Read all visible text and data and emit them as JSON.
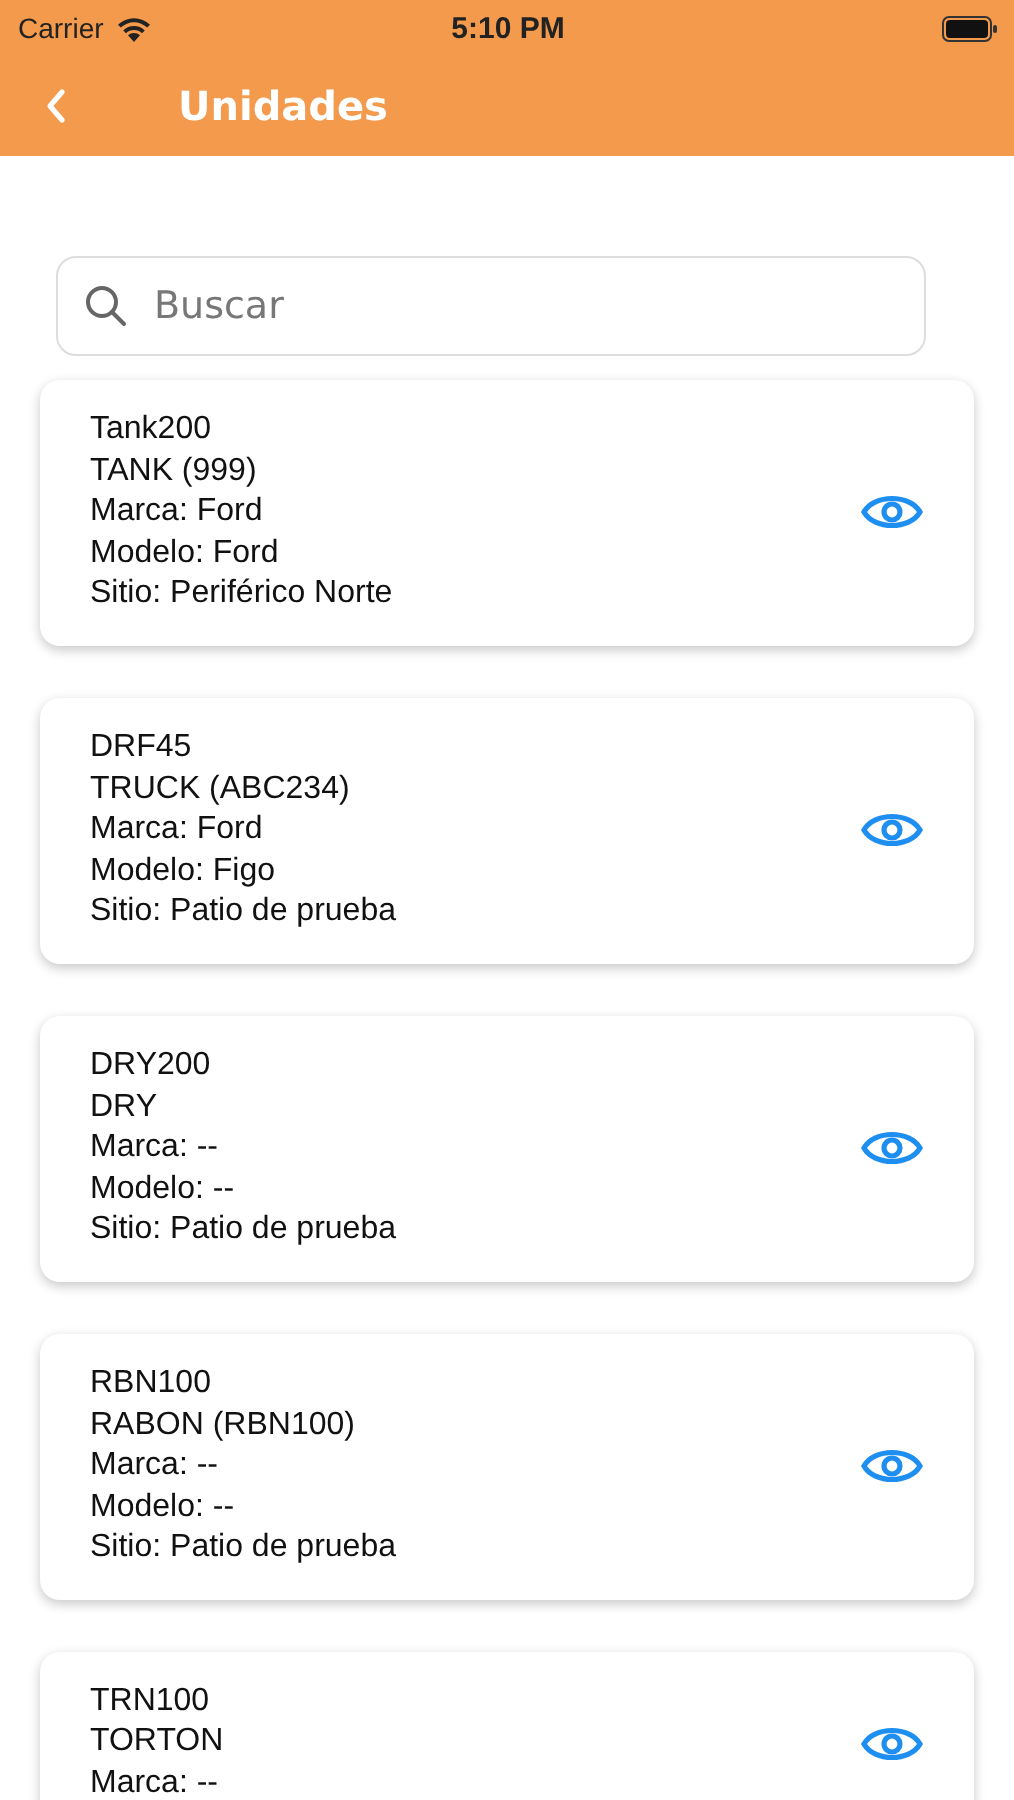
{
  "status_bar": {
    "carrier": "Carrier",
    "time": "5:10 PM"
  },
  "nav": {
    "title": "Unidades"
  },
  "search": {
    "placeholder": "Buscar"
  },
  "units": [
    {
      "lines": [
        "Tank200",
        "TANK (999)",
        "Marca: Ford",
        "Modelo: Ford",
        "Sitio: Periférico Norte"
      ]
    },
    {
      "lines": [
        "DRF45",
        "TRUCK (ABC234)",
        "Marca: Ford",
        "Modelo: Figo",
        "Sitio: Patio de prueba"
      ]
    },
    {
      "lines": [
        "DRY200",
        "DRY",
        "Marca: --",
        "Modelo: --",
        "Sitio: Patio de prueba"
      ]
    },
    {
      "lines": [
        "RBN100",
        "RABON (RBN100)",
        "Marca: --",
        "Modelo: --",
        "Sitio: Patio de prueba"
      ]
    },
    {
      "lines": [
        "TRN100",
        "TORTON",
        "Marca: --"
      ]
    }
  ]
}
